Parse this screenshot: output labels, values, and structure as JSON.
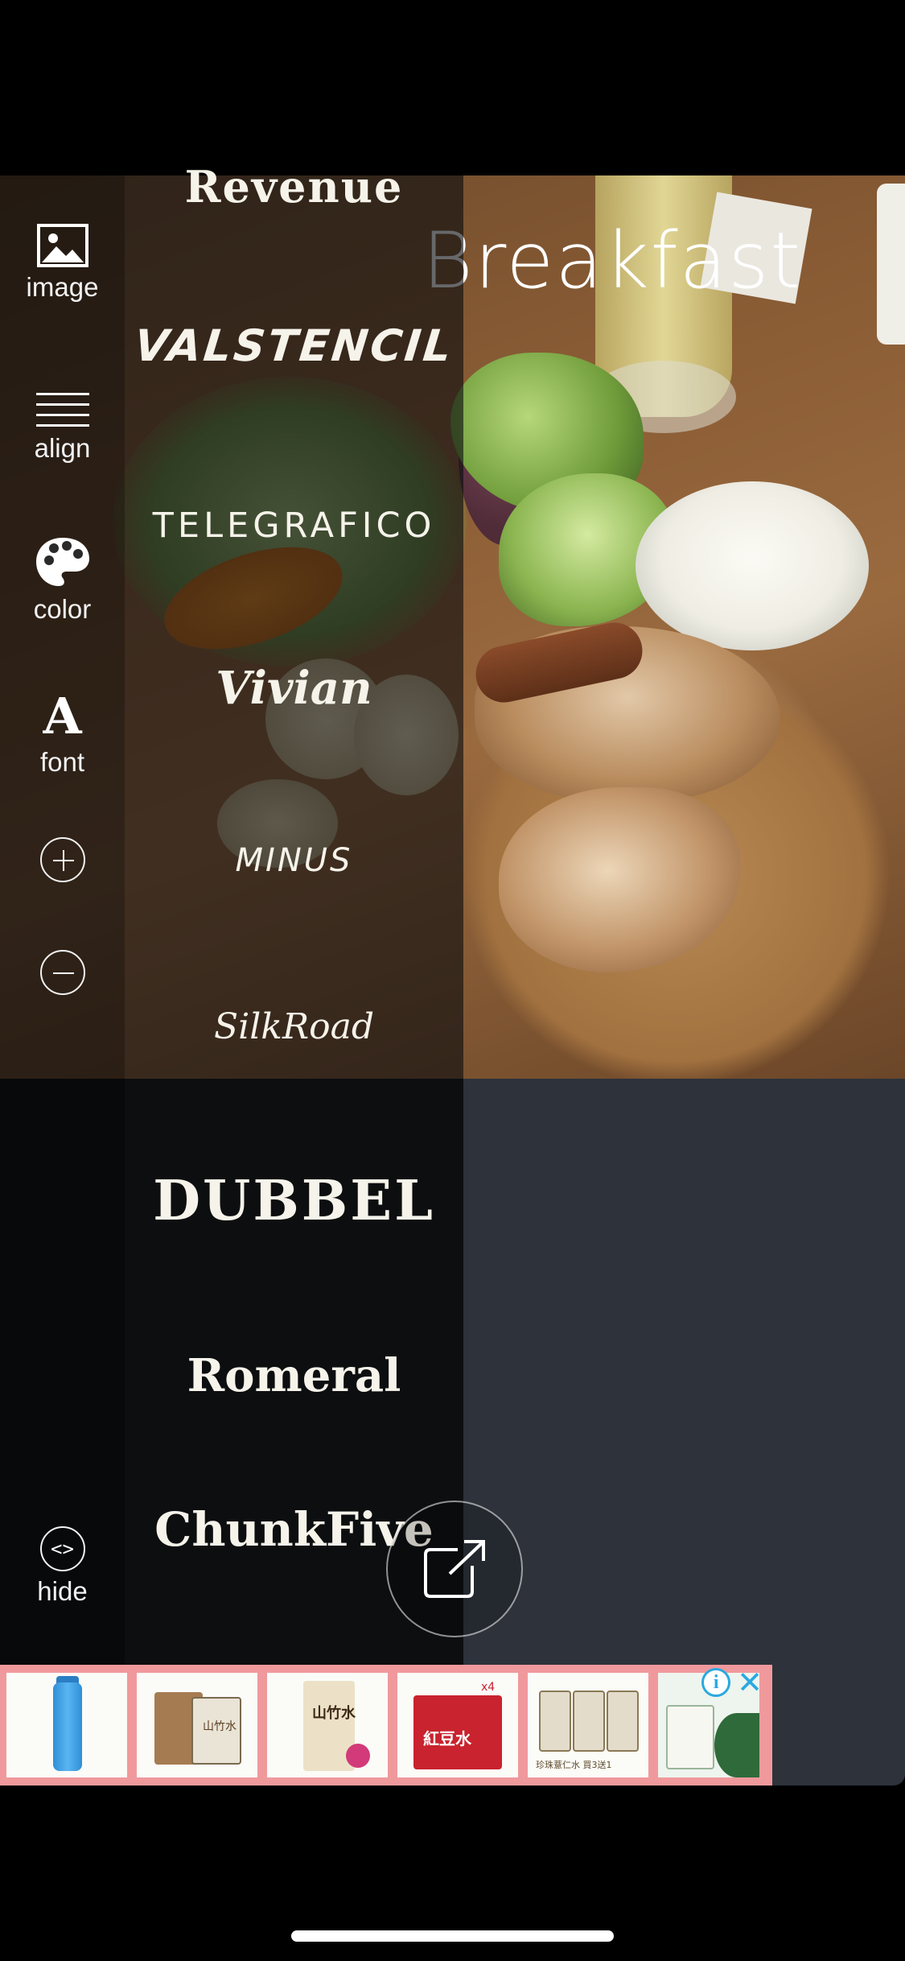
{
  "canvas": {
    "title_text": "Breakfast"
  },
  "sidebar": {
    "image": {
      "label": "image",
      "icon": "image-icon"
    },
    "align": {
      "label": "align",
      "icon": "menu-lines-icon"
    },
    "color": {
      "label": "color",
      "icon": "palette-icon"
    },
    "font": {
      "label": "font",
      "icon": "font-a-icon",
      "glyph": "A"
    },
    "zoom_in": {
      "icon": "plus-circle-icon"
    },
    "zoom_out": {
      "icon": "minus-circle-icon"
    },
    "hide": {
      "label": "hide",
      "icon": "code-brackets-icon",
      "glyph": "<>"
    }
  },
  "fonts": [
    "Revenue",
    "VALSTENCIL",
    "TELEGRAFICO",
    "Vivian",
    "MINUS",
    "SilkRoad",
    "DUBBEL",
    "Romeral",
    "ChunkFive"
  ],
  "share": {
    "icon": "share-export-icon"
  },
  "ad": {
    "product_tiles": [
      "water-bottle",
      "yam-drink-box",
      "yam-drink-pack",
      "red-bean-water-gift-box",
      "pearl-barley-water-boxes",
      "herbal-drink-box"
    ],
    "tile_texts": {
      "tile2": "山竹水",
      "tile3": "山竹水",
      "tile4_badge": "x4",
      "tile4": "紅豆水",
      "tile5": "珍珠薏仁水 買3送1"
    }
  },
  "colors": {
    "workspace_bg": "#2d323b",
    "panel_bg": "#0d0e10",
    "ad_border": "#f0999c",
    "ad_icon": "#2aa9e0"
  }
}
